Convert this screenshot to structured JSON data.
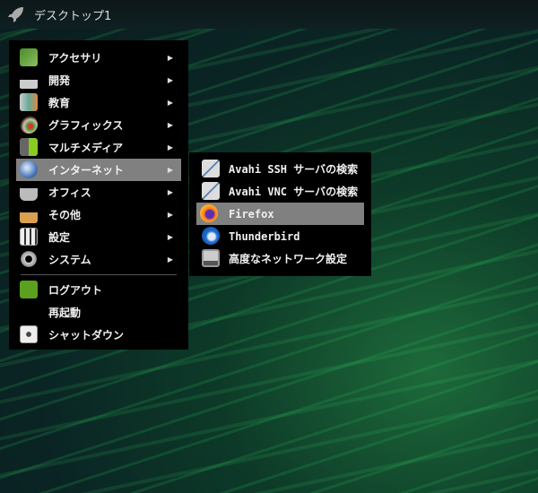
{
  "topbar": {
    "title": "デスクトップ1",
    "icon": "rocket-icon"
  },
  "main_menu": {
    "items": [
      {
        "label": "アクセサリ",
        "icon": "accessories-icon",
        "submenu": true
      },
      {
        "label": "開発",
        "icon": "development-icon",
        "submenu": true
      },
      {
        "label": "教育",
        "icon": "education-icon",
        "submenu": true
      },
      {
        "label": "グラフィックス",
        "icon": "graphics-icon",
        "submenu": true
      },
      {
        "label": "マルチメディア",
        "icon": "multimedia-icon",
        "submenu": true
      },
      {
        "label": "インターネット",
        "icon": "globe-icon",
        "submenu": true,
        "highlighted": true
      },
      {
        "label": "オフィス",
        "icon": "office-icon",
        "submenu": true
      },
      {
        "label": "その他",
        "icon": "other-icon",
        "submenu": true
      },
      {
        "label": "設定",
        "icon": "settings-icon",
        "submenu": true
      },
      {
        "label": "システム",
        "icon": "gear-icon",
        "submenu": true
      }
    ],
    "session": [
      {
        "label": "ログアウト",
        "icon": "logout-icon"
      },
      {
        "label": "再起動",
        "icon": ""
      },
      {
        "label": "シャットダウン",
        "icon": "shutdown-icon"
      }
    ],
    "arrow": "▶"
  },
  "internet_submenu": {
    "items": [
      {
        "label": "Avahi SSH サーバの検索",
        "icon": "avahi-icon"
      },
      {
        "label": "Avahi VNC サーバの検索",
        "icon": "avahi-icon"
      },
      {
        "label": "Firefox",
        "icon": "firefox-icon",
        "highlighted": true
      },
      {
        "label": "Thunderbird",
        "icon": "thunderbird-icon"
      },
      {
        "label": "高度なネットワーク設定",
        "icon": "network-icon"
      }
    ]
  },
  "colors": {
    "highlight": "#808080",
    "menu_bg": "#000000"
  }
}
